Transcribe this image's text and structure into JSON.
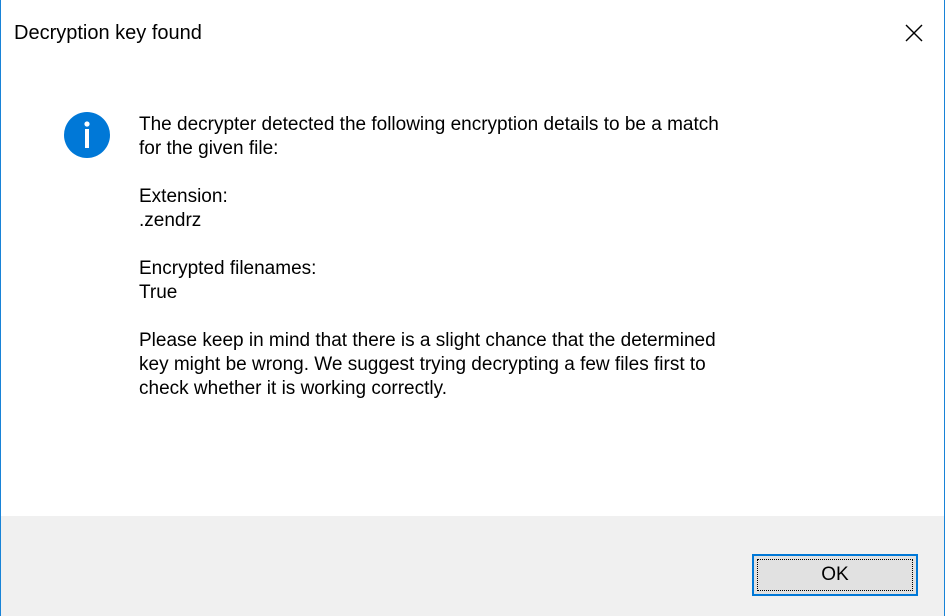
{
  "window": {
    "title": "Decryption key found",
    "close_icon": "close-icon"
  },
  "message": {
    "icon": "info-icon",
    "intro_line_1": "The decrypter detected the following encryption details to be a match",
    "intro_line_2": "for the given file:",
    "extension_label": "Extension:",
    "extension_value": ".zendrz",
    "filenames_label": "Encrypted filenames:",
    "filenames_value": "True",
    "warning_line_1": "Please keep in mind that there is a slight chance that the determined",
    "warning_line_2": "key might be wrong. We suggest trying decrypting a few files first to",
    "warning_line_3": "check whether it is working correctly."
  },
  "footer": {
    "ok_label": "OK"
  },
  "colors": {
    "border": "#1883d7",
    "info_icon": "#0078d7",
    "footer_bg": "#f0f0f0",
    "button_bg": "#e1e1e1",
    "button_border": "#0078d7"
  }
}
